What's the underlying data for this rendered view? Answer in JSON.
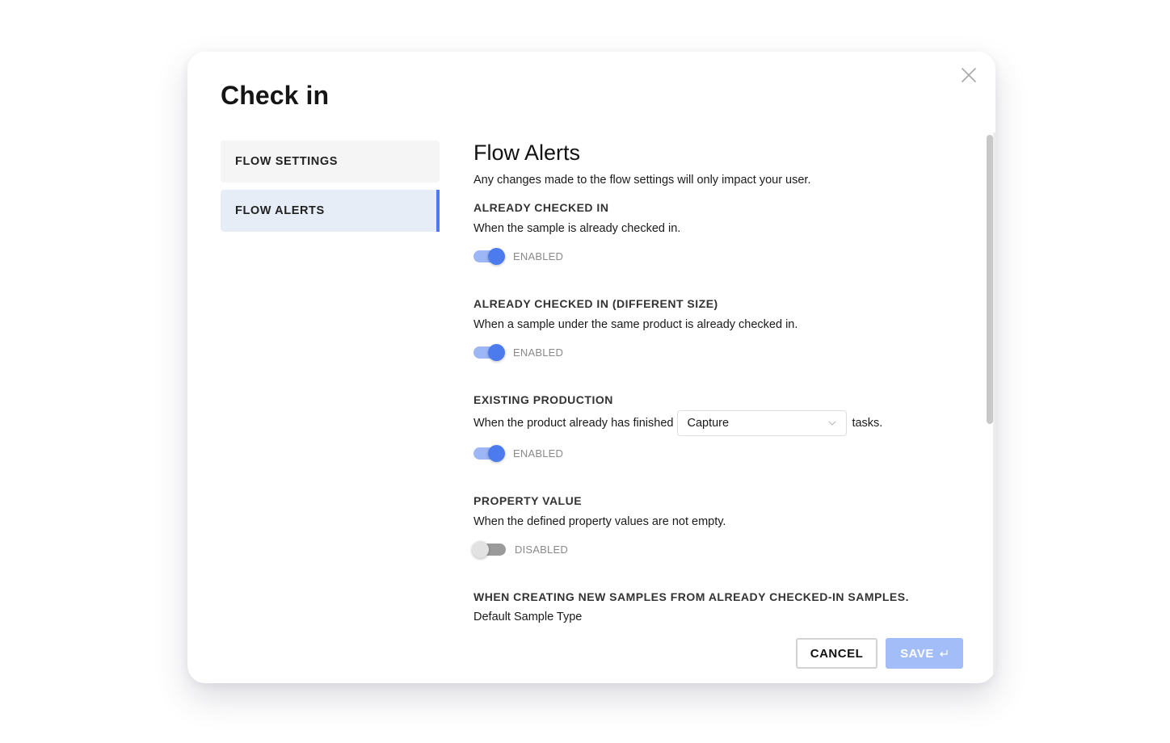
{
  "modal": {
    "title": "Check in",
    "close_icon": "close-icon"
  },
  "sidebar": {
    "items": [
      {
        "label": "FLOW SETTINGS",
        "active": false
      },
      {
        "label": "FLOW ALERTS",
        "active": true
      }
    ]
  },
  "content": {
    "title": "Flow Alerts",
    "description": "Any changes made to the flow settings will only impact your user.",
    "alerts": [
      {
        "title": "ALREADY CHECKED IN",
        "description": "When the sample is already checked in.",
        "toggle_state": "ENABLED",
        "enabled": true
      },
      {
        "title": "ALREADY CHECKED IN (DIFFERENT SIZE)",
        "description": "When a sample under the same product is already checked in.",
        "toggle_state": "ENABLED",
        "enabled": true
      },
      {
        "title": "EXISTING PRODUCTION",
        "description_prefix": "When the product already has finished",
        "select_value": "Capture",
        "description_suffix": "tasks.",
        "toggle_state": "ENABLED",
        "enabled": true
      },
      {
        "title": "PROPERTY VALUE",
        "description": "When the defined property values are not empty.",
        "toggle_state": "DISABLED",
        "enabled": false
      },
      {
        "title": "WHEN CREATING NEW SAMPLES FROM ALREADY CHECKED-IN SAMPLES.",
        "description": "Default Sample Type"
      }
    ]
  },
  "footer": {
    "cancel_label": "CANCEL",
    "save_label": "SAVE",
    "save_icon": "enter-key-icon"
  },
  "colors": {
    "accent": "#4b7bec",
    "accent_light": "#9db6f6",
    "save_disabled": "#a2bdf8",
    "active_nav_bg": "#e7edf6",
    "nav_bg": "#f5f5f5"
  }
}
